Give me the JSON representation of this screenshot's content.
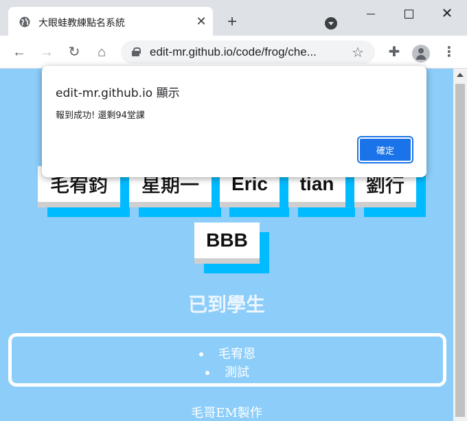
{
  "browser": {
    "tab": {
      "title": "大眼蛙教練點名系統",
      "favicon": "globe-icon"
    },
    "url": "edit-mr.github.io/code/frog/che...",
    "icons": {
      "back": "back-arrow-icon",
      "forward": "forward-arrow-icon",
      "reload": "reload-icon",
      "home": "home-icon",
      "bookmark": "star-icon",
      "extensions": "puzzle-icon",
      "profile": "avatar-icon",
      "menu": "kebab-menu-icon"
    }
  },
  "dialog": {
    "title": "edit-mr.github.io 顯示",
    "message": "報到成功! 還剩94堂課",
    "ok_label": "確定",
    "ok_color": "#1a73e8"
  },
  "page": {
    "background": "#8ccdf9",
    "accent": "#00bbff",
    "students": [
      {
        "name": "毛宥鈞"
      },
      {
        "name": "星期一"
      },
      {
        "name": "Eric"
      },
      {
        "name": "tian"
      },
      {
        "name": "劉行"
      },
      {
        "name": "BBB"
      }
    ],
    "arrived_title": "已到學生",
    "arrived": [
      "毛宥恩",
      "測試"
    ],
    "footer": "毛哥EM製作"
  }
}
